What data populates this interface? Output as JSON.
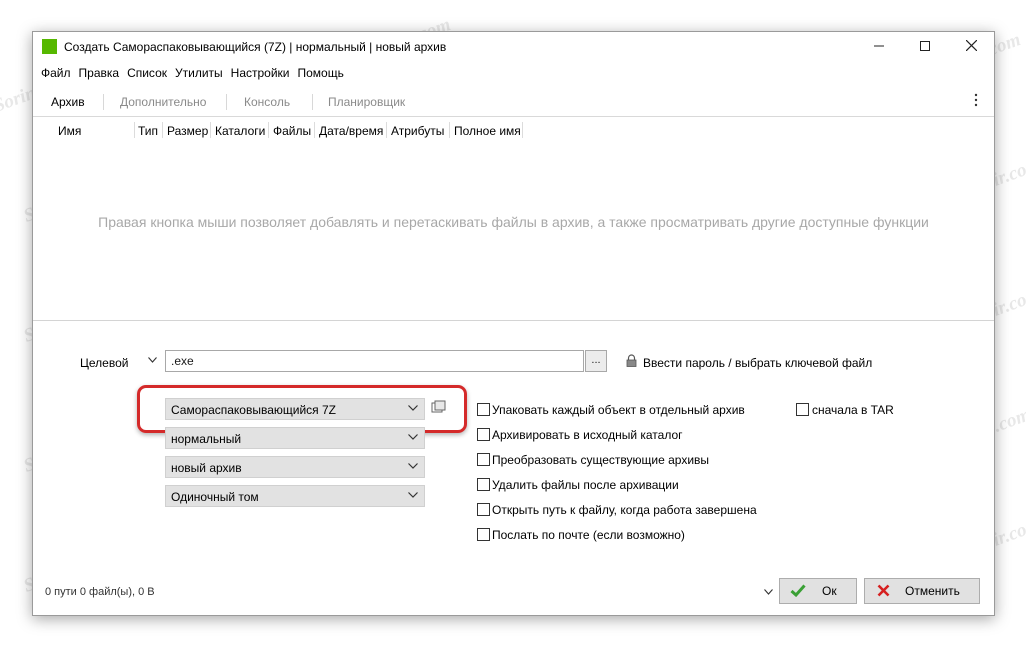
{
  "window": {
    "title": "Создать Самораспаковывающийся (7Z) | нормальный | новый архив",
    "accent": "#56b800"
  },
  "menu": [
    "Файл",
    "Правка",
    "Список",
    "Утилиты",
    "Настройки",
    "Помощь"
  ],
  "tabs": [
    "Архив",
    "Дополнительно",
    "Консоль",
    "Планировщик"
  ],
  "columns": [
    "Имя",
    "Тип",
    "Размер",
    "Каталоги",
    "Файлы",
    "Дата/время",
    "Атрибуты",
    "Полное имя"
  ],
  "hint": "Правая кнопка мыши позволяет добавлять и перетаскивать файлы в архив, а также просматривать другие доступные функции",
  "target": {
    "label": "Целевой",
    "value": ".exe",
    "browse_label": "...",
    "password_link": "Ввести пароль / выбрать ключевой файл"
  },
  "combos": {
    "format": "Самораспаковывающийся 7Z",
    "level": "нормальный",
    "mode": "новый архив",
    "volume": "Одиночный том"
  },
  "options": [
    {
      "label": "Упаковать каждый объект в отдельный архив",
      "checked": false
    },
    {
      "label": "Архивировать в исходный каталог",
      "checked": false
    },
    {
      "label": "Преобразовать существующие архивы",
      "checked": false
    },
    {
      "label": "Удалить файлы после архивации",
      "checked": false
    },
    {
      "label": "Открыть путь к файлу, когда работа завершена",
      "checked": false
    },
    {
      "label": "Послать по почте (если возможно)",
      "checked": false
    }
  ],
  "tar_option": {
    "label": "сначала в TAR",
    "checked": false
  },
  "status": "0 пути 0 файл(ы), 0 B",
  "buttons": {
    "ok": "Ок",
    "cancel": "Отменить"
  },
  "watermark": "Soringpcrepair.com",
  "colors": {
    "ok_check": "#3aa035",
    "cancel_x": "#d62020",
    "highlight": "#d42a2a"
  }
}
